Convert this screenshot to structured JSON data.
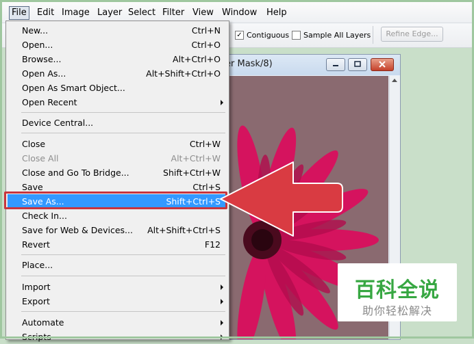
{
  "menubar": {
    "items": [
      "File",
      "Edit",
      "Image",
      "Layer",
      "Select",
      "Filter",
      "View",
      "Window",
      "Help"
    ]
  },
  "options_bar": {
    "contiguous_label": "Contiguous",
    "contiguous_checked": true,
    "sample_all_label": "Sample All Layers",
    "sample_all_checked": false,
    "refine_edge_label": "Refine Edge..."
  },
  "document": {
    "title_fragment": "er Mask/8)"
  },
  "file_menu": {
    "items": [
      {
        "label": "New...",
        "shortcut": "Ctrl+N"
      },
      {
        "label": "Open...",
        "shortcut": "Ctrl+O"
      },
      {
        "label": "Browse...",
        "shortcut": "Alt+Ctrl+O"
      },
      {
        "label": "Open As...",
        "shortcut": "Alt+Shift+Ctrl+O"
      },
      {
        "label": "Open As Smart Object...",
        "shortcut": ""
      },
      {
        "label": "Open Recent",
        "shortcut": ""
      },
      {
        "label": "Device Central...",
        "shortcut": ""
      },
      {
        "label": "Close",
        "shortcut": "Ctrl+W"
      },
      {
        "label": "Close All",
        "shortcut": "Alt+Ctrl+W"
      },
      {
        "label": "Close and Go To Bridge...",
        "shortcut": "Shift+Ctrl+W"
      },
      {
        "label": "Save",
        "shortcut": "Ctrl+S"
      },
      {
        "label": "Save As...",
        "shortcut": "Shift+Ctrl+S"
      },
      {
        "label": "Check In...",
        "shortcut": ""
      },
      {
        "label": "Save for Web & Devices...",
        "shortcut": "Alt+Shift+Ctrl+S"
      },
      {
        "label": "Revert",
        "shortcut": "F12"
      },
      {
        "label": "Place...",
        "shortcut": ""
      },
      {
        "label": "Import",
        "shortcut": ""
      },
      {
        "label": "Export",
        "shortcut": ""
      },
      {
        "label": "Automate",
        "shortcut": ""
      },
      {
        "label": "Scripts",
        "shortcut": ""
      }
    ]
  },
  "watermark": {
    "title": "百科全说",
    "subtitle": "助你轻松解决"
  },
  "colors": {
    "highlight": "#3399ff",
    "callout_red": "#d93b42",
    "brand_green": "#37a742"
  }
}
